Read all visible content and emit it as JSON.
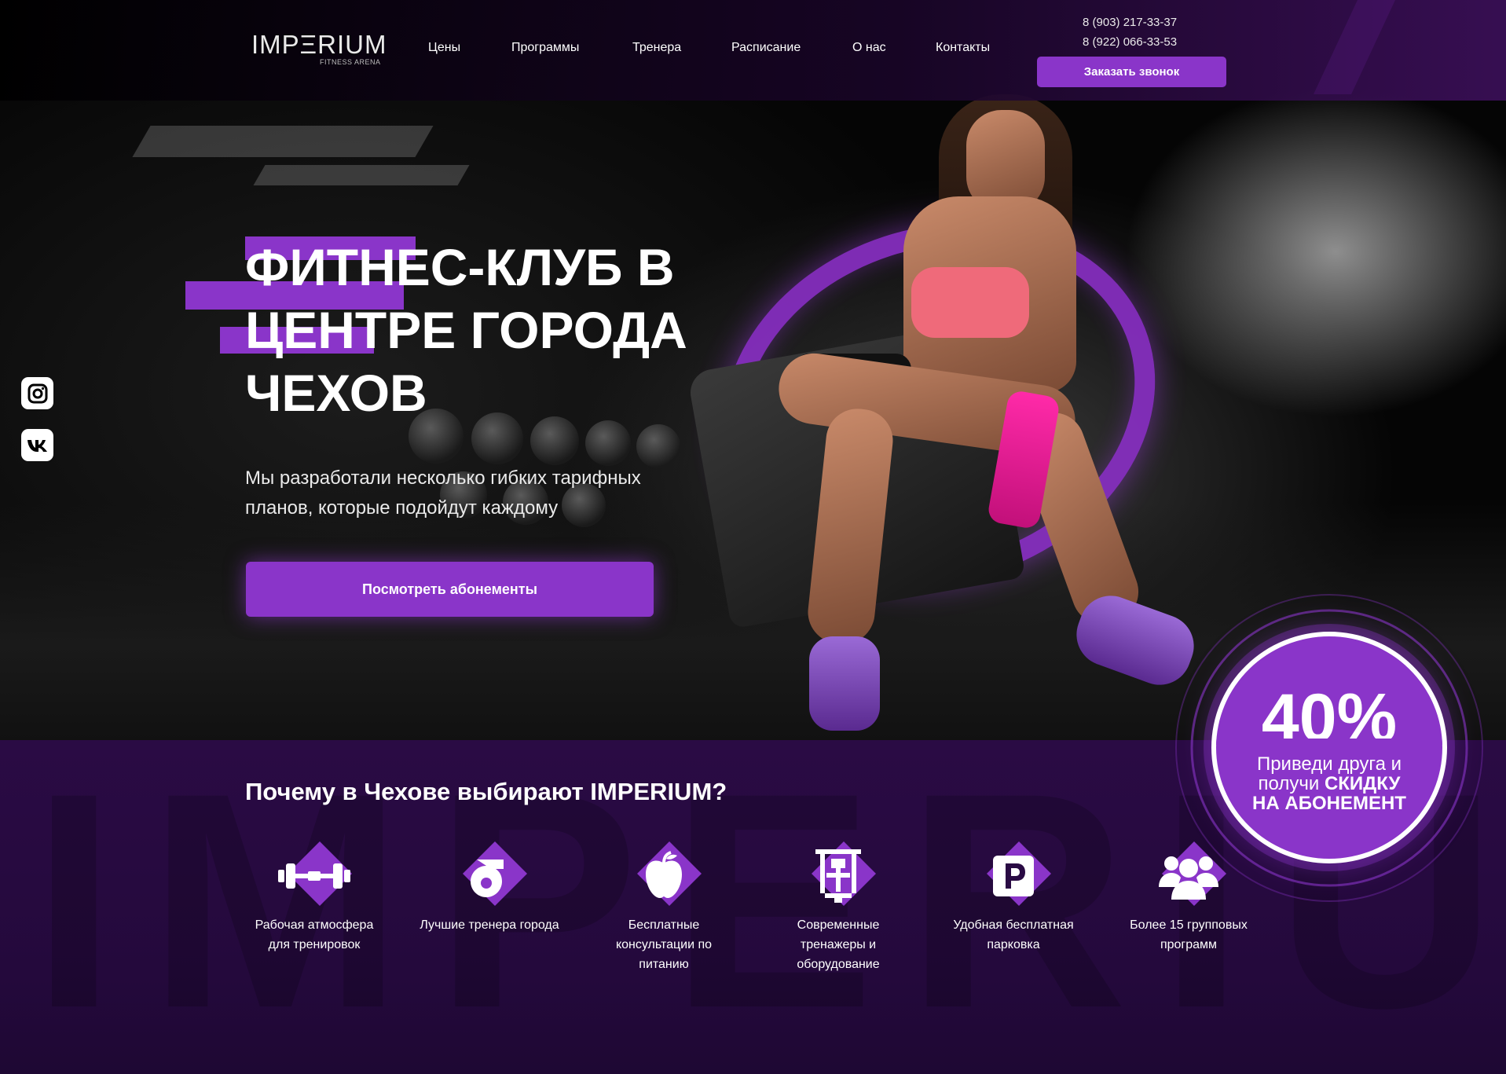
{
  "header": {
    "logo_text": "IMPΞRIUM",
    "logo_sub": "FITNESS ARENA",
    "nav": [
      "Цены",
      "Программы",
      "Тренера",
      "Расписание",
      "О нас",
      "Контакты"
    ],
    "phones": [
      "8 (903) 217-33-37",
      "8 (922) 066-33-53"
    ],
    "callback_label": "Заказать звонок"
  },
  "hero": {
    "title_lines": [
      "ФИТНЕС-КЛУБ В",
      "ЦЕНТРЕ ГОРОДА",
      "ЧЕХОВ"
    ],
    "subtitle": "Мы разработали несколько гибких тарифных планов, которые подойдут каждому",
    "cta_label": "Посмотреть абонементы"
  },
  "social": {
    "items": [
      {
        "name": "instagram-icon"
      },
      {
        "name": "vk-icon"
      }
    ]
  },
  "why": {
    "title_regular": "Почему в Чехове",
    "title_bold": "выбирают IMPERIUM?",
    "watermark": "IMPERIUM",
    "features": [
      {
        "label": "Рабочая атмосфера для тренировок",
        "icon": "dumbbell-icon"
      },
      {
        "label": "Лучшие тренера города",
        "icon": "whistle-icon"
      },
      {
        "label": "Бесплатные консультации по питанию",
        "icon": "apple-icon"
      },
      {
        "label": "Современные тренажеры и оборудование",
        "icon": "gym-machine-icon"
      },
      {
        "label": "Удобная бесплатная парковка",
        "icon": "parking-icon"
      },
      {
        "label": "Более 15 групповых программ",
        "icon": "group-icon"
      }
    ]
  },
  "promo": {
    "percent": "40%",
    "line1": "Приведи друга и",
    "line2_regular": "получи",
    "line2_bold": "СКИДКУ",
    "line3": "НА АБОНЕМЕНТ"
  },
  "colors": {
    "accent": "#8a35c9",
    "section_bg": "#2a0b44"
  }
}
